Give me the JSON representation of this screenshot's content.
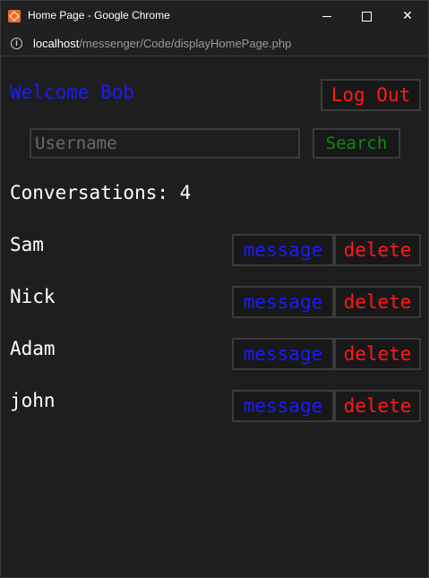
{
  "window": {
    "title": "Home Page - Google Chrome",
    "url_host": "localhost",
    "url_path": "/messenger/Code/displayHomePage.php"
  },
  "header": {
    "welcome": "Welcome Bob",
    "logout_label": "Log Out"
  },
  "search": {
    "placeholder": "Username",
    "button_label": "Search"
  },
  "conversations": {
    "heading": "Conversations: 4",
    "items": [
      {
        "name": "Sam",
        "message_label": "message",
        "delete_label": "delete"
      },
      {
        "name": "Nick",
        "message_label": "message",
        "delete_label": "delete"
      },
      {
        "name": "Adam",
        "message_label": "message",
        "delete_label": "delete"
      },
      {
        "name": "john",
        "message_label": "message",
        "delete_label": "delete"
      }
    ]
  },
  "colors": {
    "background": "#1e1e1e",
    "welcome": "#1a1aff",
    "logout": "#ff1a1a",
    "search": "#0f8a0f",
    "message": "#1a1aff",
    "delete": "#ff1a1a"
  },
  "icons": [
    "app-icon",
    "info-icon",
    "minimize-icon",
    "maximize-icon",
    "close-icon"
  ]
}
